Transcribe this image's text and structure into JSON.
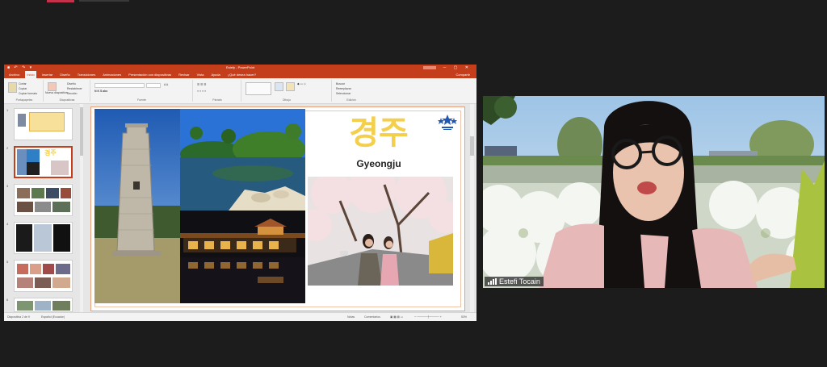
{
  "app": {
    "window_title": "Estefy - PowerPoint",
    "account_label": "Iniciar sesión",
    "ribbon_tabs": [
      "Archivo",
      "Inicio",
      "Insertar",
      "Diseño",
      "Transiciones",
      "Animaciones",
      "Presentación con diapositivas",
      "Revisar",
      "Vista",
      "Ayuda",
      "¿Qué desea hacer?"
    ],
    "active_tab": "Inicio",
    "share_label": "Compartir",
    "ribbon_groups": [
      "Portapapeles",
      "Diapositivas",
      "Fuente",
      "Párrafo",
      "Dibujo",
      "Edición"
    ],
    "ribbon_items": {
      "paste": "Pegar",
      "cut": "Cortar",
      "copy": "Copiar",
      "format_painter": "Copiar formato",
      "new_slide": "Nueva diapositiva",
      "layout": "Diseño",
      "reset": "Restablecer",
      "section": "Sección",
      "find": "Buscar",
      "replace": "Reemplazar",
      "select": "Seleccionar"
    }
  },
  "thumbnails": [
    {
      "num": "1",
      "selected": false
    },
    {
      "num": "2",
      "selected": true
    },
    {
      "num": "3",
      "selected": false
    },
    {
      "num": "4",
      "selected": false
    },
    {
      "num": "5",
      "selected": false
    },
    {
      "num": "6",
      "selected": false
    }
  ],
  "slide": {
    "title_korean": "경주",
    "title_english": "Gyeongju"
  },
  "status": {
    "slide_counter": "Diapositiva 2 de 9",
    "language": "Español (Ecuador)",
    "notes": "Notas",
    "comments": "Comentarios",
    "zoom": "53%"
  },
  "participant": {
    "name": "Estefi Tocain"
  },
  "colors": {
    "ppt_accent": "#c43e1c",
    "meeting_bg": "#1c1c1c",
    "title_yellow": "#f3cf4b"
  }
}
